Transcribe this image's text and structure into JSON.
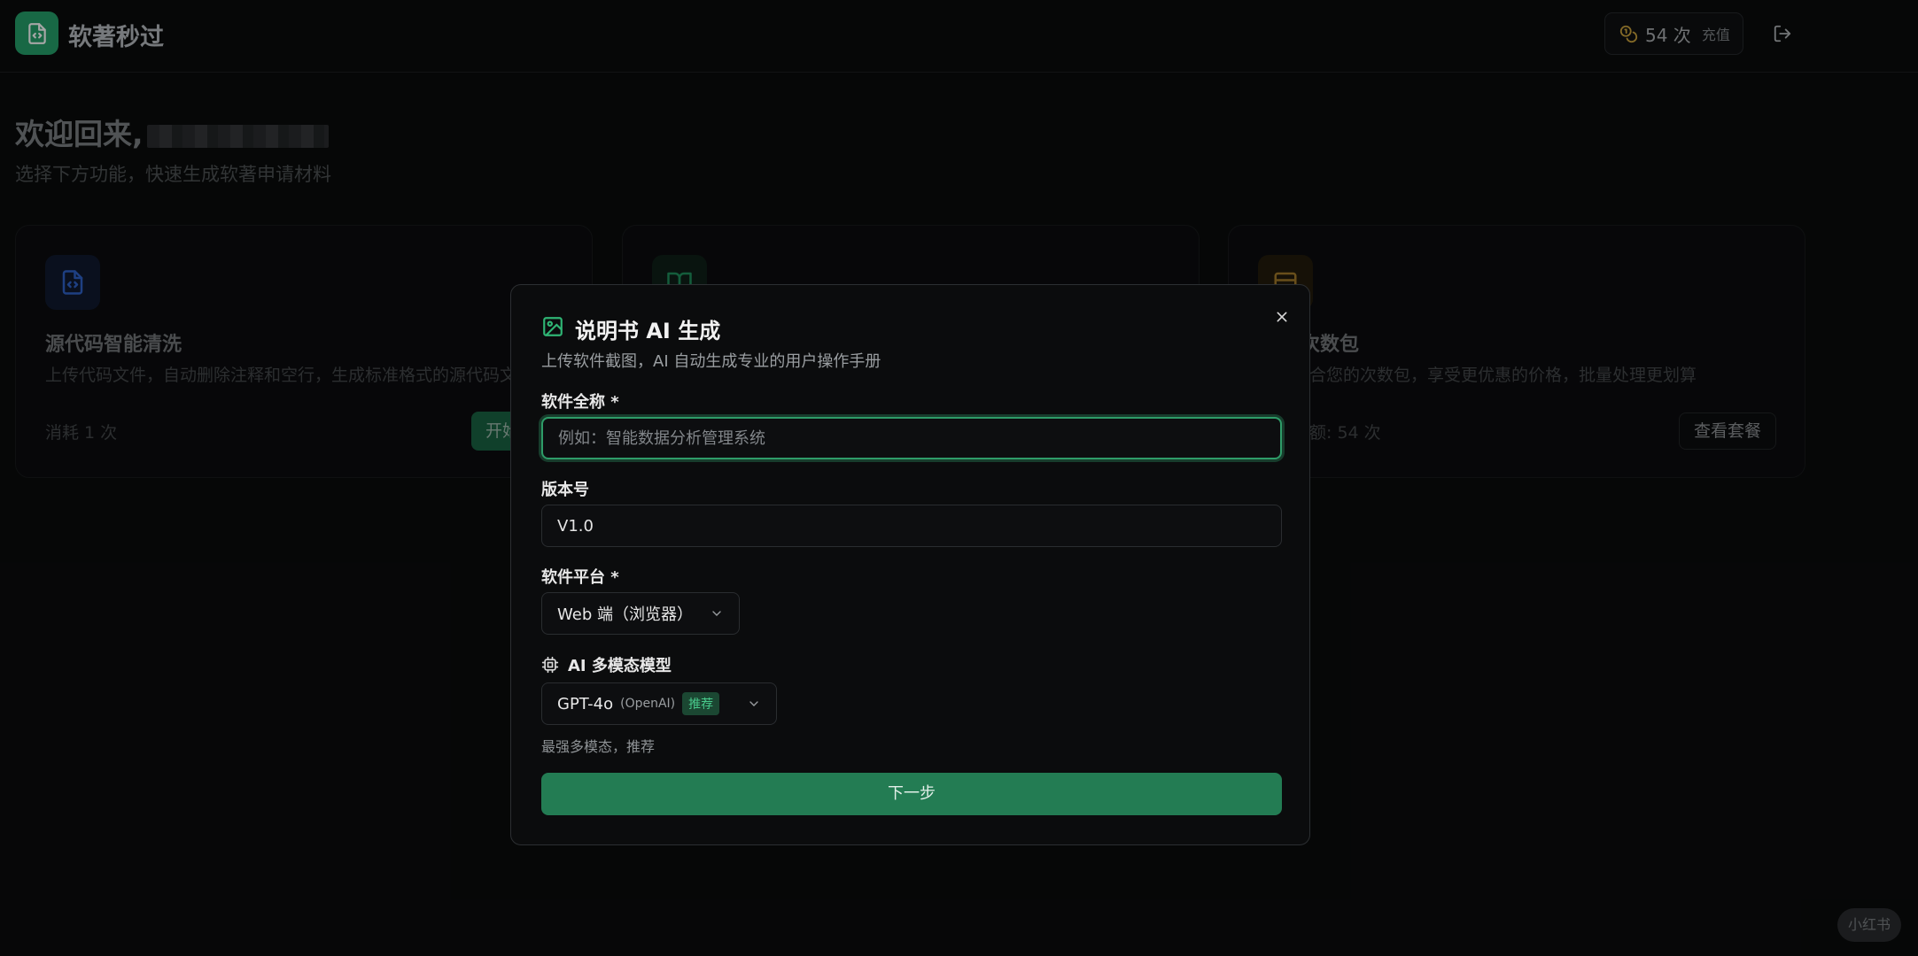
{
  "header": {
    "app_title": "软著秒过",
    "credits": "54 次",
    "recharge_label": "充值"
  },
  "welcome": {
    "title": "欢迎回来,",
    "subtitle": "选择下方功能，快速生成软著申请材料"
  },
  "cards": [
    {
      "title": "源代码智能清洗",
      "desc": "上传代码文件，自动删除注释和空行，生成标准格式的源代码文",
      "cost": "消耗 1 次",
      "button": "开始"
    },
    {
      "title": "",
      "desc": "",
      "cost": "",
      "button": ""
    },
    {
      "title": "次数包",
      "desc": "合您的次数包，享受更优惠的价格，批量处理更划算",
      "cost": "额: 54 次",
      "button": "查看套餐"
    }
  ],
  "modal": {
    "title": "说明书 AI 生成",
    "subtitle": "上传软件截图，AI 自动生成专业的用户操作手册",
    "name_label": "软件全称 *",
    "name_placeholder": "例如：智能数据分析管理系统",
    "version_label": "版本号",
    "version_value": "V1.0",
    "platform_label": "软件平台 *",
    "platform_value": "Web 端（浏览器）",
    "model_label": "AI 多模态模型",
    "model_name": "GPT-4o",
    "model_provider": "(OpenAI)",
    "model_badge": "推荐",
    "model_hint": "最强多模态，推荐",
    "next_button": "下一步"
  },
  "watermark": "小红书",
  "colors": {
    "accent": "#237c53",
    "focus_ring": "#2e9c68",
    "badge_text": "#48c98b"
  }
}
